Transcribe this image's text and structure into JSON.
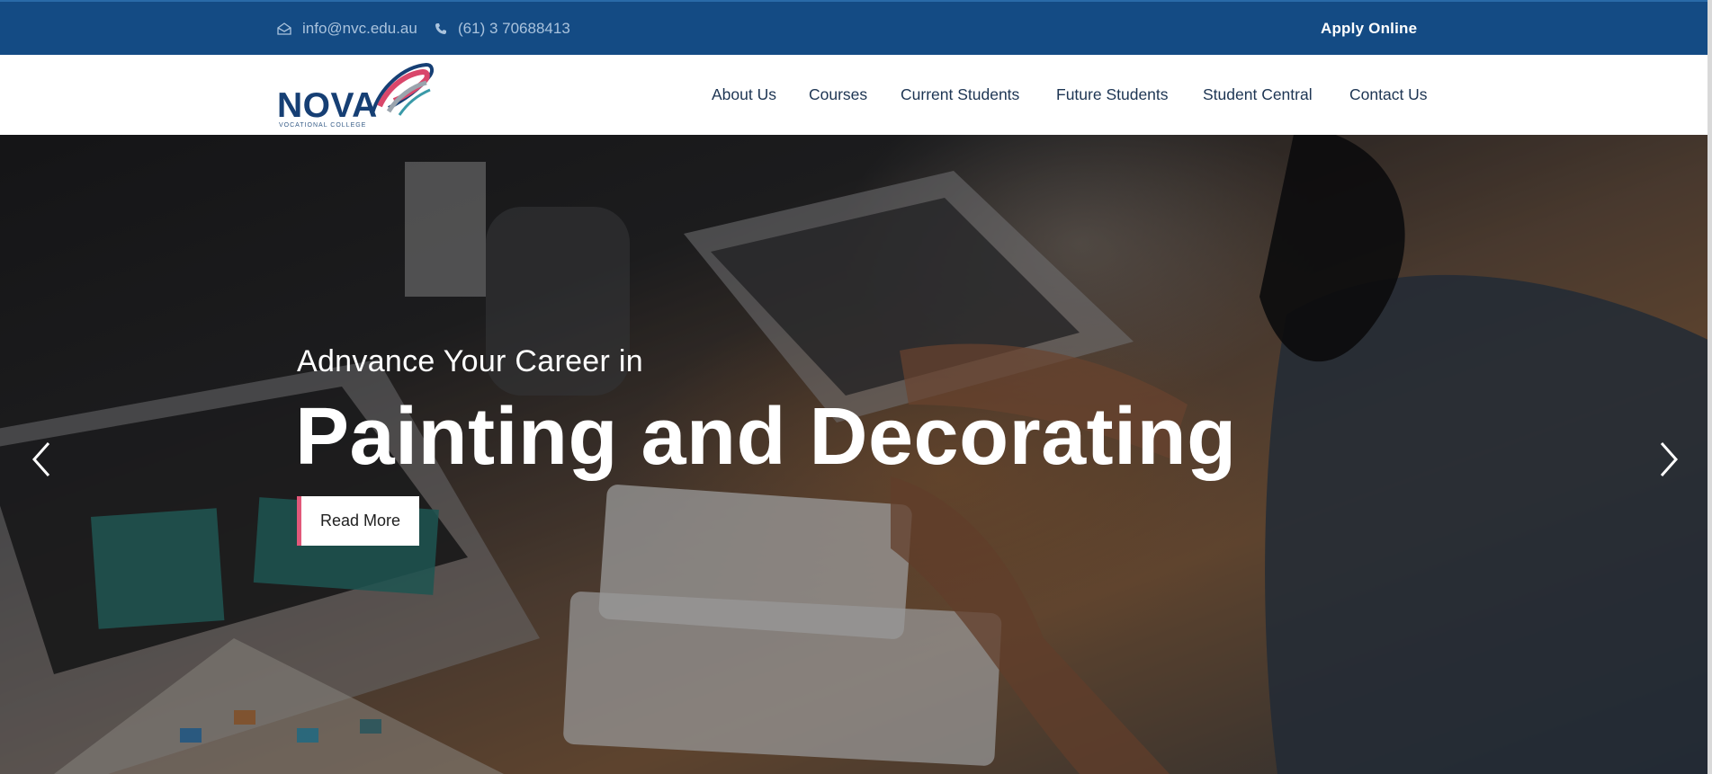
{
  "topbar": {
    "email": "info@nvc.edu.au",
    "phone": "(61) 3 70688413",
    "apply_label": "Apply Online",
    "icons": {
      "email": "envelope-icon",
      "phone": "phone-icon"
    }
  },
  "logo": {
    "name": "NOVA",
    "tagline": "VOCATIONAL COLLEGE"
  },
  "nav": {
    "items": [
      {
        "label": "About Us"
      },
      {
        "label": "Courses"
      },
      {
        "label": "Current Students"
      },
      {
        "label": "Future Students"
      },
      {
        "label": "Student Central"
      },
      {
        "label": "Contact Us"
      }
    ]
  },
  "hero": {
    "subtitle": "Adnvance Your Career in",
    "title": "Painting and Decorating",
    "cta_label": "Read More",
    "prev_icon": "chevron-left-icon",
    "next_icon": "chevron-right-icon"
  },
  "colors": {
    "topbar_bg": "#144b84",
    "brand_navy": "#163f74",
    "accent_pink": "#e2587a",
    "nav_text": "#1d3553"
  }
}
